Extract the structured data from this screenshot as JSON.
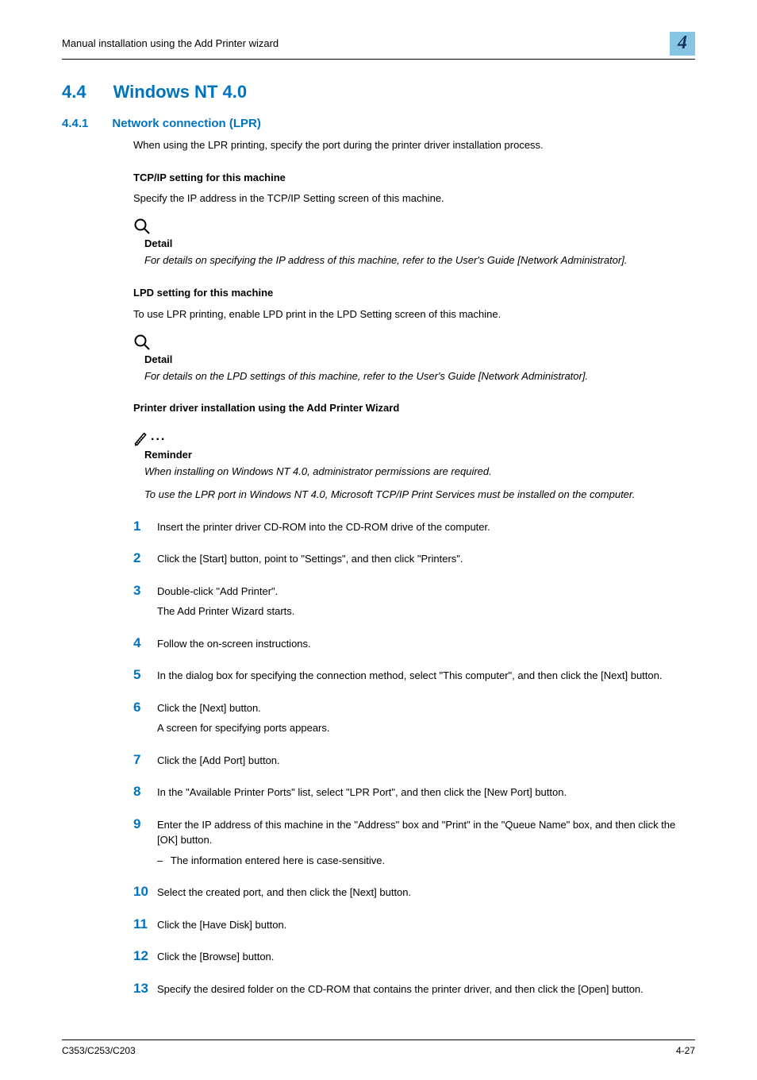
{
  "header": {
    "breadcrumb": "Manual installation using the Add Printer wizard",
    "chapter": "4"
  },
  "h1": {
    "num": "4.4",
    "title": "Windows NT 4.0"
  },
  "h2": {
    "num": "4.4.1",
    "title": "Network connection (LPR)"
  },
  "intro": "When using the LPR printing, specify the port during the printer driver installation process.",
  "sec1": {
    "heading": "TCP/IP setting for this machine",
    "body": "Specify the IP address in the TCP/IP Setting screen of this machine.",
    "note_title": "Detail",
    "note_body": "For details on specifying the IP address of this machine, refer to the User's Guide [Network Administrator]."
  },
  "sec2": {
    "heading": "LPD setting for this machine",
    "body": "To use LPR printing, enable LPD print in the LPD Setting screen of this machine.",
    "note_title": "Detail",
    "note_body": "For details on the LPD settings of this machine, refer to the User's Guide [Network Administrator]."
  },
  "sec3": {
    "heading": "Printer driver installation using the Add Printer Wizard",
    "note_title": "Reminder",
    "note_p1": "When installing on Windows NT 4.0, administrator permissions are required.",
    "note_p2": "To use the LPR port in Windows NT 4.0, Microsoft TCP/IP Print Services must be installed on the computer."
  },
  "steps": [
    {
      "n": "1",
      "lines": [
        "Insert the printer driver CD-ROM into the CD-ROM drive of the computer."
      ]
    },
    {
      "n": "2",
      "lines": [
        "Click the [Start] button, point to \"Settings\", and then click \"Printers\"."
      ]
    },
    {
      "n": "3",
      "lines": [
        "Double-click \"Add Printer\".",
        "The Add Printer Wizard starts."
      ]
    },
    {
      "n": "4",
      "lines": [
        "Follow the on-screen instructions."
      ]
    },
    {
      "n": "5",
      "lines": [
        "In the dialog box for specifying the connection method, select \"This computer\", and then click the [Next] button."
      ]
    },
    {
      "n": "6",
      "lines": [
        "Click the [Next] button.",
        "A screen for specifying ports appears."
      ]
    },
    {
      "n": "7",
      "lines": [
        "Click the [Add Port] button."
      ]
    },
    {
      "n": "8",
      "lines": [
        "In the \"Available Printer Ports\" list, select \"LPR Port\", and then click the [New Port] button."
      ]
    },
    {
      "n": "9",
      "lines": [
        "Enter the IP address of this machine in the \"Address\" box and \"Print\" in the \"Queue Name\" box, and then click the [OK] button."
      ],
      "sub": "The information entered here is case-sensitive."
    },
    {
      "n": "10",
      "lines": [
        "Select the created port, and then click the [Next] button."
      ]
    },
    {
      "n": "11",
      "lines": [
        "Click the [Have Disk] button."
      ]
    },
    {
      "n": "12",
      "lines": [
        "Click the [Browse] button."
      ]
    },
    {
      "n": "13",
      "lines": [
        "Specify the desired folder on the CD-ROM that contains the printer driver, and then click the [Open] button."
      ]
    }
  ],
  "footer": {
    "left": "C353/C253/C203",
    "right": "4-27"
  }
}
